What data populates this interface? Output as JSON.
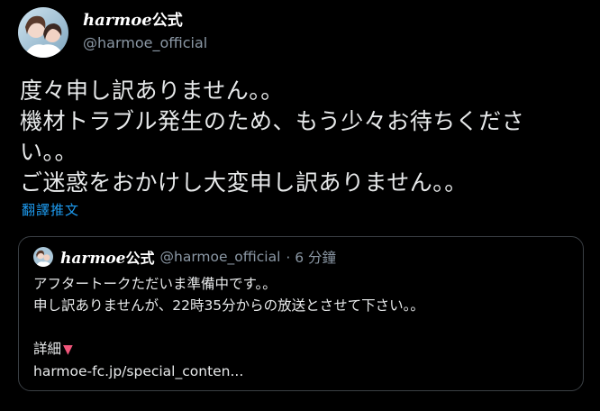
{
  "author": {
    "brand": "harmoe",
    "suffix": "公式",
    "handle": "@harmoe_official"
  },
  "tweet": {
    "lines": [
      "度々申し訳ありません。。",
      "機材トラブル発生のため、もう少々お待ちくださ",
      "い。。",
      "ご迷惑をおかけし大変申し訳ありません。。"
    ],
    "translate_label": "翻譯推文"
  },
  "quote": {
    "brand": "harmoe",
    "suffix": "公式",
    "handle": "@harmoe_official",
    "time": "· 6 分鐘",
    "lines": [
      "アフタートークただいま準備中です。。",
      "申し訳ありませんが、22時35分からの放送とさせて下さい。。"
    ],
    "details_label": "詳細",
    "link": "harmoe-fc.jp/special_conten..."
  },
  "icons": {
    "avatar": "avatar-photo",
    "details": "down-triangle-icon"
  },
  "colors": {
    "background": "#000000",
    "text": "#e7e9ea",
    "muted": "#8b98a5",
    "link": "#1d9bf0",
    "accent": "#f0557a"
  }
}
